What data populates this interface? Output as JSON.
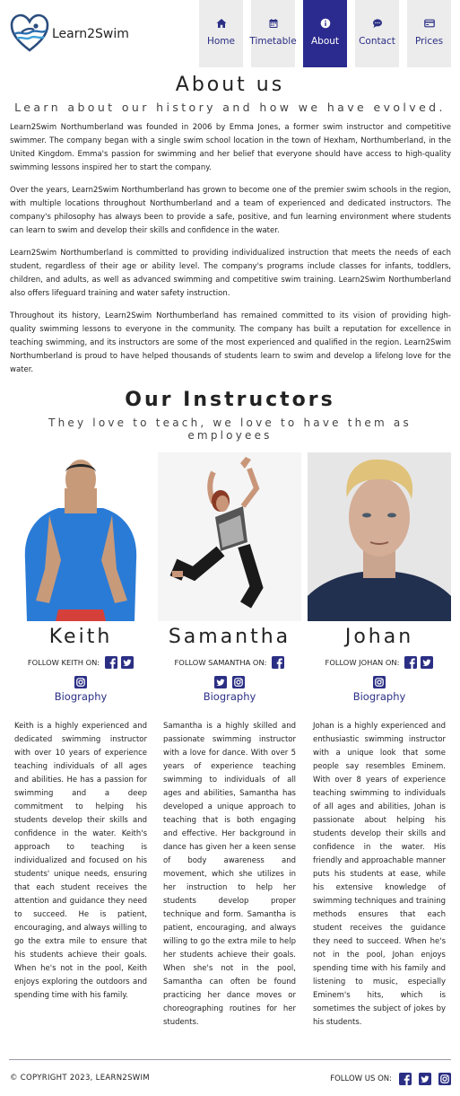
{
  "brand": {
    "name": "Learn2Swim",
    "accent": "#2b2b8f"
  },
  "nav": [
    {
      "label": "Home",
      "icon": "home-icon",
      "active": false
    },
    {
      "label": "Timetable",
      "icon": "calendar-icon",
      "active": false
    },
    {
      "label": "About",
      "icon": "info-icon",
      "active": true
    },
    {
      "label": "Contact",
      "icon": "chat-icon",
      "active": false
    },
    {
      "label": "Prices",
      "icon": "card-icon",
      "active": false
    }
  ],
  "about": {
    "title": "About us",
    "subtitle": "Learn about our history and how we have evolved.",
    "paragraphs": [
      "Learn2Swim Northumberland was founded in 2006 by Emma Jones, a former swim instructor and competitive swimmer. The company began with a single swim school location in the town of Hexham, Northumberland, in the United Kingdom. Emma's passion for swimming and her belief that everyone should have access to high-quality swimming lessons inspired her to start the company.",
      "Over the years, Learn2Swim Northumberland has grown to become one of the premier swim schools in the region, with multiple locations throughout Northumberland and a team of experienced and dedicated instructors. The company's philosophy has always been to provide a safe, positive, and fun learning environment where students can learn to swim and develop their skills and confidence in the water.",
      "Learn2Swim Northumberland is committed to providing individualized instruction that meets the needs of each student, regardless of their age or ability level. The company's programs include classes for infants, toddlers, children, and adults, as well as advanced swimming and competitive swim training. Learn2Swim Northumberland also offers lifeguard training and water safety instruction.",
      "Throughout its history, Learn2Swim Northumberland has remained committed to its vision of providing high-quality swimming lessons to everyone in the community. The company has built a reputation for excellence in teaching swimming, and its instructors are some of the most experienced and qualified in the region. Learn2Swim Northumberland is proud to have helped thousands of students learn to swim and develop a lifelong love for the water."
    ]
  },
  "instructors_section": {
    "title": "Our Instructors",
    "subtitle": "They love to teach, we love to have them as employees"
  },
  "instructors": [
    {
      "name": "Keith",
      "follow_label": "FOLLOW KEITH ON:",
      "row1_icons": [
        "facebook-icon",
        "twitter-icon"
      ],
      "row2_icons": [
        "instagram-icon"
      ],
      "biography_label": "Biography",
      "bio": "Keith is a highly experienced and dedicated swimming instructor with over 10 years of experience teaching individuals of all ages and abilities. He has a passion for swimming and a deep commitment to helping his students develop their skills and confidence in the water. Keith's approach to teaching is individualized and focused on his students' unique needs, ensuring that each student receives the attention and guidance they need to succeed. He is patient, encouraging, and always willing to go the extra mile to ensure that his students achieve their goals. When he's not in the pool, Keith enjoys exploring the outdoors and spending time with his family."
    },
    {
      "name": "Samantha",
      "follow_label": "FOLLOW SAMANTHA ON:",
      "row1_icons": [
        "facebook-icon"
      ],
      "row2_icons": [
        "twitter-icon",
        "instagram-icon"
      ],
      "biography_label": "Biography",
      "bio": "Samantha is a highly skilled and passionate swimming instructor with a love for dance. With over 5 years of experience teaching swimming to individuals of all ages and abilities, Samantha has developed a unique approach to teaching that is both engaging and effective. Her background in dance has given her a keen sense of body awareness and movement, which she utilizes in her instruction to help her students develop proper technique and form. Samantha is patient, encouraging, and always willing to go the extra mile to help her students achieve their goals. When she's not in the pool, Samantha can often be found practicing her dance moves or choreographing routines for her students."
    },
    {
      "name": "Johan",
      "follow_label": "FOLLOW JOHAN ON:",
      "row1_icons": [
        "facebook-icon",
        "twitter-icon"
      ],
      "row2_icons": [
        "instagram-icon"
      ],
      "biography_label": "Biography",
      "bio": "Johan is a highly experienced and enthusiastic swimming instructor with a unique look that some people say resembles Eminem. With over 8 years of experience teaching swimming to individuals of all ages and abilities, Johan is passionate about helping his students develop their skills and confidence in the water. His friendly and approachable manner puts his students at ease, while his extensive knowledge of swimming techniques and training methods ensures that each student receives the guidance they need to succeed. When he's not in the pool, Johan enjoys spending time with his family and listening to music, especially Eminem's hits, which is sometimes the subject of jokes by his students."
    }
  ],
  "footer": {
    "copyright": "© COPYRIGHT 2023, LEARN2SWIM",
    "follow_label": "FOLLOW US ON:",
    "icons": [
      "facebook-icon",
      "twitter-icon",
      "instagram-icon"
    ]
  }
}
